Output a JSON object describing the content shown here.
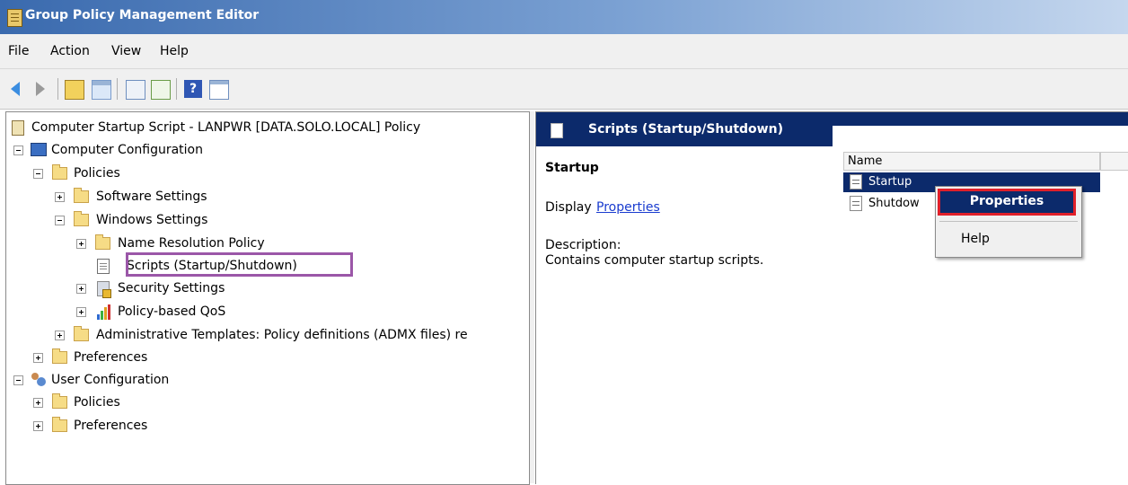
{
  "window": {
    "title": "Group Policy Management Editor"
  },
  "menu": [
    "File",
    "Action",
    "View",
    "Help"
  ],
  "toolbar": {
    "icons": [
      "back-icon",
      "forward-icon",
      "up-folder-icon",
      "show-hide-tree-icon",
      "properties-list-icon",
      "export-icon",
      "help-icon",
      "console-tree-icon"
    ]
  },
  "tree": {
    "root": "Computer Startup Script - LANPWR [DATA.SOLO.LOCAL] Policy",
    "computer_config": "Computer Configuration",
    "policies": "Policies",
    "software_settings": "Software Settings",
    "windows_settings": "Windows Settings",
    "name_resolution": "Name Resolution Policy",
    "scripts": "Scripts (Startup/Shutdown)",
    "security_settings": "Security Settings",
    "qos": "Policy-based QoS",
    "admin_templates": "Administrative Templates: Policy definitions (ADMX files) re",
    "preferences": "Preferences",
    "user_config": "User Configuration",
    "user_policies": "Policies",
    "user_preferences": "Preferences"
  },
  "details": {
    "header": "Scripts (Startup/Shutdown)",
    "heading": "Startup",
    "display_prefix": "Display",
    "display_link": "Properties",
    "description_label": "Description:",
    "description": "Contains computer startup scripts.",
    "column_name": "Name",
    "items": [
      "Startup",
      "Shutdow"
    ]
  },
  "context_menu": {
    "properties": "Properties",
    "help": "Help"
  },
  "colors": {
    "header_bg": "#0c2a6b",
    "highlight_border": "#9b57a8",
    "menu_focus_border": "#e0202a"
  }
}
